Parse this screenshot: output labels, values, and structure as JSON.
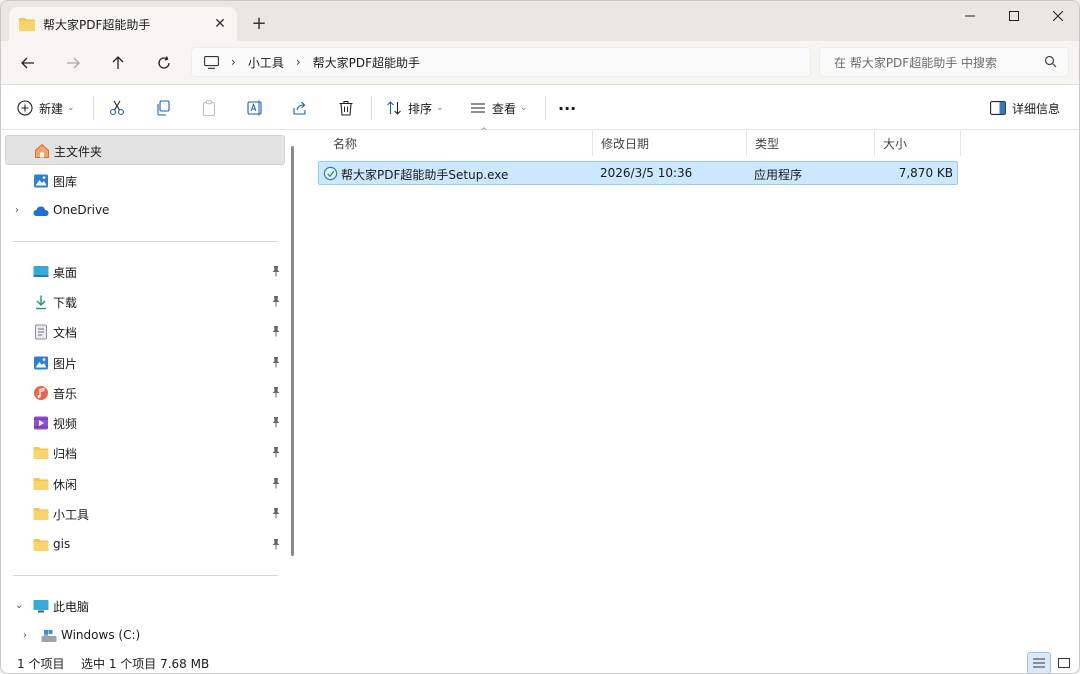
{
  "tab": {
    "title": "帮大家PDF超能助手",
    "close": "✕",
    "new": "+"
  },
  "window": {
    "minimize": "—",
    "maximize": "☐",
    "close": "✕"
  },
  "address": {
    "crumbs": [
      "小工具",
      "帮大家PDF超能助手"
    ],
    "sep": "›"
  },
  "search": {
    "placeholder": "在 帮大家PDF超能助手 中搜索"
  },
  "toolbar": {
    "new_label": "新建",
    "sort_label": "排序",
    "view_label": "查看",
    "more": "···",
    "details_label": "详细信息"
  },
  "sidebar": {
    "top": [
      {
        "label": "主文件夹",
        "icon": "home-icon"
      },
      {
        "label": "图库",
        "icon": "gallery-icon"
      },
      {
        "label": "OneDrive",
        "icon": "cloud-icon"
      }
    ],
    "quick": [
      {
        "label": "桌面",
        "icon": "desktop-icon"
      },
      {
        "label": "下载",
        "icon": "download-icon"
      },
      {
        "label": "文档",
        "icon": "document-icon"
      },
      {
        "label": "图片",
        "icon": "picture-icon"
      },
      {
        "label": "音乐",
        "icon": "music-icon"
      },
      {
        "label": "视频",
        "icon": "video-icon"
      },
      {
        "label": "归档",
        "icon": "folder-icon"
      },
      {
        "label": "休闲",
        "icon": "folder-icon"
      },
      {
        "label": "小工具",
        "icon": "folder-icon"
      },
      {
        "label": "gis",
        "icon": "folder-icon"
      }
    ],
    "pc": [
      {
        "label": "此电脑",
        "icon": "computer-icon"
      },
      {
        "label": "Windows (C:)",
        "icon": "drive-icon"
      }
    ]
  },
  "columns": [
    "名称",
    "修改日期",
    "类型",
    "大小"
  ],
  "files": [
    {
      "name": "帮大家PDF超能助手Setup.exe",
      "modified": "2026/3/5 10:36",
      "type": "应用程序",
      "size": "7,870 KB"
    }
  ],
  "status": {
    "count": "1 个项目",
    "selected": "选中 1 个项目  7.68 MB"
  },
  "colors": {
    "selection": "#cce8ff",
    "selection_border": "#99c9f5",
    "folder": "#f4c54f",
    "accent": "#0067c0"
  }
}
